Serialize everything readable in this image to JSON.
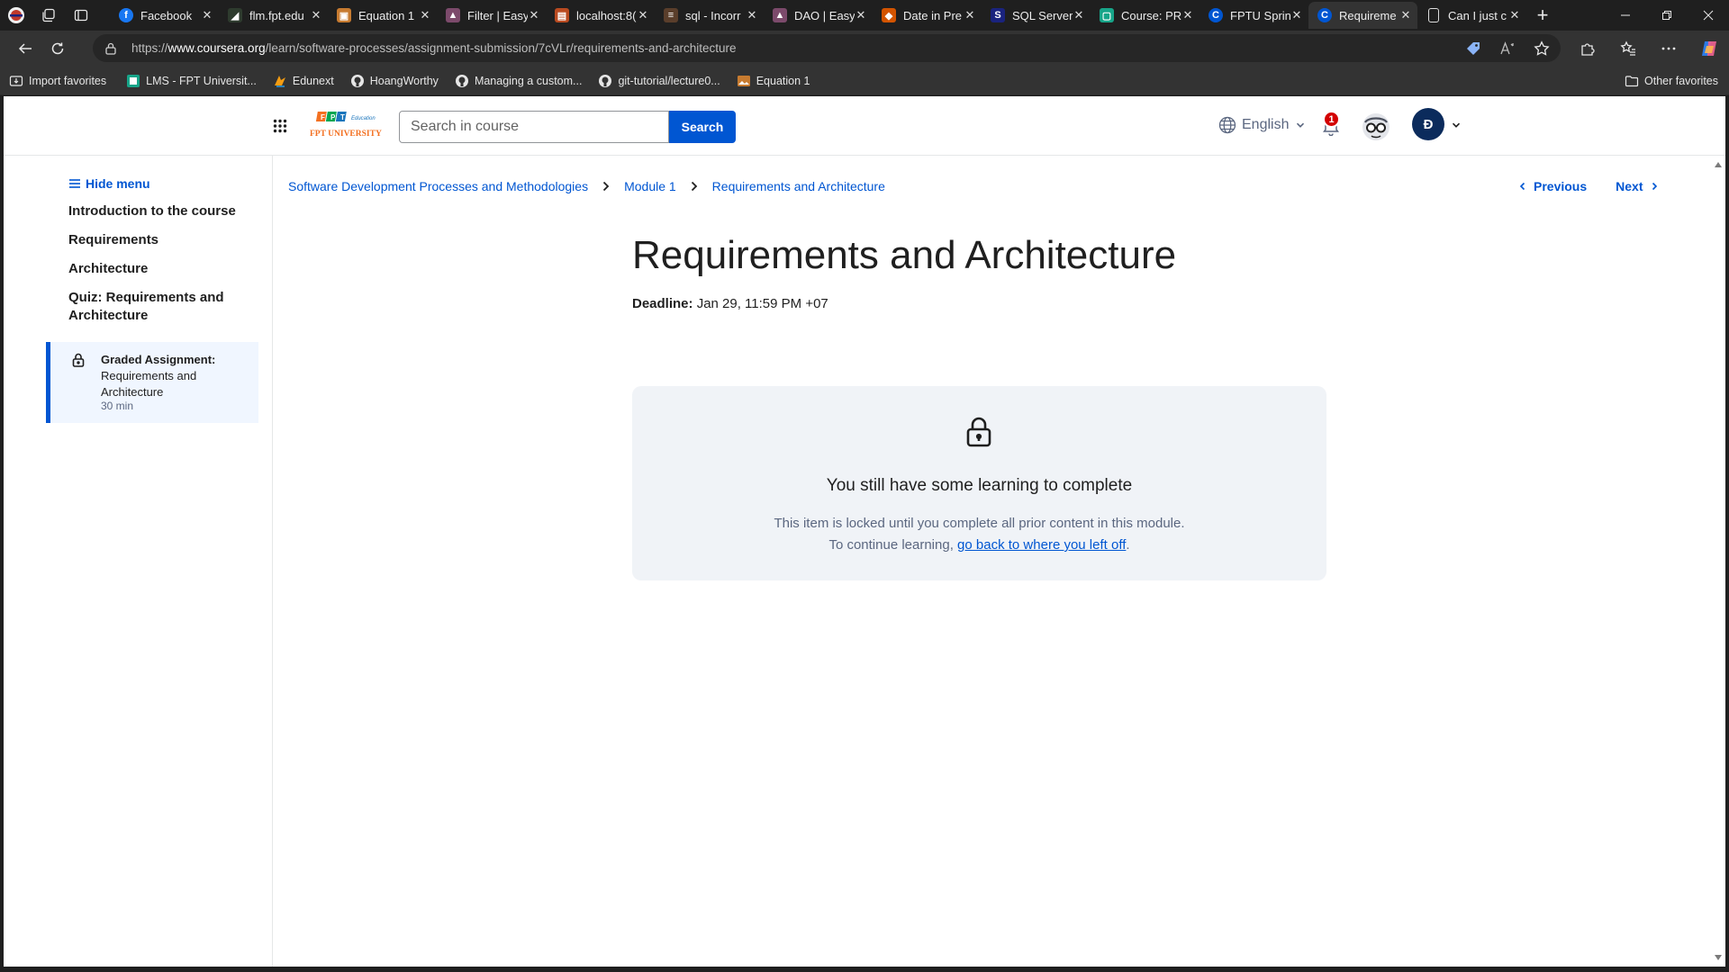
{
  "browser": {
    "tabs": [
      {
        "label": "Facebook",
        "favicon": "facebook-icon",
        "color": "#1877f2"
      },
      {
        "label": "flm.fpt.edu",
        "favicon": "leaf-icon",
        "color": "#2e7d32"
      },
      {
        "label": "Equation 1",
        "favicon": "image-icon",
        "color": "#c77b30"
      },
      {
        "label": "Filter | Easy",
        "favicon": "easy-icon",
        "color": "#7c4a6b"
      },
      {
        "label": "localhost:8(",
        "favicon": "localhost-icon",
        "color": "#b94a20"
      },
      {
        "label": "sql - Incorr",
        "favicon": "stack-icon",
        "color": "#5a3e2b"
      },
      {
        "label": "DAO | Easy",
        "favicon": "easy-icon",
        "color": "#7c4a6b"
      },
      {
        "label": "Date in Pre",
        "favicon": "ms-icon",
        "color": "#d35400"
      },
      {
        "label": "SQL Server",
        "favicon": "sqlserver-icon",
        "color": "#1a237e"
      },
      {
        "label": "Course: PR",
        "favicon": "lms-icon",
        "color": "#17a589"
      },
      {
        "label": "FPTU Sprin",
        "favicon": "coursera-icon",
        "color": "#0056d2"
      },
      {
        "label": "Requireme",
        "favicon": "coursera-icon",
        "color": "#0056d2",
        "active": true
      },
      {
        "label": "Can I just c",
        "favicon": "page-icon",
        "color": "#9e9e9e"
      }
    ],
    "url_prefix": "https://",
    "url_domain": "www.coursera.org",
    "url_path": "/learn/software-processes/assignment-submission/7cVLr/requirements-and-architecture",
    "favorites": [
      {
        "label": "Import favorites",
        "icon": "import-icon"
      },
      {
        "label": "LMS - FPT Universit...",
        "icon": "lms-icon"
      },
      {
        "label": "Edunext",
        "icon": "edunext-icon"
      },
      {
        "label": "HoangWorthy",
        "icon": "github-icon"
      },
      {
        "label": "Managing a custom...",
        "icon": "github-icon"
      },
      {
        "label": "git-tutorial/lecture0...",
        "icon": "github-icon"
      },
      {
        "label": "Equation 1",
        "icon": "image-icon"
      }
    ],
    "other_favorites": "Other favorites"
  },
  "header": {
    "logo_text": "FPT UNIVERSITY",
    "logo_sub": "Education",
    "search_placeholder": "Search in course",
    "search_button": "Search",
    "language": "English",
    "notification_count": "1",
    "avatar_initial": "Đ"
  },
  "sidebar": {
    "hide_menu": "Hide menu",
    "items": [
      {
        "label": "Introduction to the course"
      },
      {
        "label": "Requirements"
      },
      {
        "label": "Architecture"
      },
      {
        "label": "Quiz: Requirements and Architecture"
      }
    ],
    "active_item": {
      "type_label": "Graded Assignment:",
      "title": "Requirements and Architecture",
      "duration": "30 min"
    }
  },
  "breadcrumb": {
    "course": "Software Development Processes and Methodologies",
    "module": "Module 1",
    "item": "Requirements and Architecture"
  },
  "nav": {
    "previous": "Previous",
    "next": "Next"
  },
  "main": {
    "title": "Requirements and Architecture",
    "deadline_label": "Deadline:",
    "deadline_value": "Jan 29, 11:59 PM +07",
    "locked_title": "You still have some learning to complete",
    "locked_message": "This item is locked until you complete all prior content in this module.",
    "continue_prefix": "To continue learning, ",
    "continue_link": "go back to where you left off",
    "continue_suffix": "."
  },
  "colors": {
    "brand_blue": "#0056d2",
    "notification_red": "#d30001",
    "avatar_navy": "#0b2b5c",
    "card_bg": "#f0f3f7"
  }
}
